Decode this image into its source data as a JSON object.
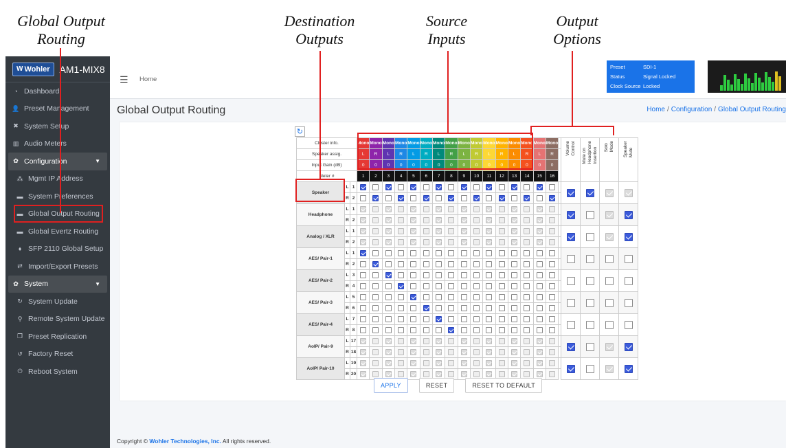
{
  "callouts": {
    "routing_l1": "Global Output",
    "routing_l2": "Routing",
    "dest_l1": "Destination",
    "dest_l2": "Outputs",
    "src_l1": "Source",
    "src_l2": "Inputs",
    "opt_l1": "Output",
    "opt_l2": "Options"
  },
  "brand": {
    "logo": "Wohler",
    "model": "AM1-MIX8"
  },
  "nav": [
    {
      "label": "Dashboard",
      "icon": "tachometer-icon",
      "glyph": "◔",
      "kind": "item"
    },
    {
      "label": "Preset Management",
      "icon": "users-icon",
      "glyph": "👤",
      "kind": "item"
    },
    {
      "label": "System Setup",
      "icon": "tools-icon",
      "glyph": "✖",
      "kind": "item"
    },
    {
      "label": "Audio Meters",
      "icon": "chart-icon",
      "glyph": "▥",
      "kind": "item"
    },
    {
      "label": "Configuration",
      "icon": "cog-icon",
      "glyph": "✿",
      "kind": "group"
    },
    {
      "label": "Mgmt IP Address",
      "icon": "network-icon",
      "glyph": "⁂",
      "kind": "sub"
    },
    {
      "label": "System Preferences",
      "icon": "card-icon",
      "glyph": "▬",
      "kind": "sub"
    },
    {
      "label": "Global Output Routing",
      "icon": "card-icon",
      "glyph": "▬",
      "kind": "sub"
    },
    {
      "label": "Global Evertz Routing",
      "icon": "card-icon",
      "glyph": "▬",
      "kind": "sub"
    },
    {
      "label": "SFP 2110 Global Setup",
      "icon": "plug-icon",
      "glyph": "♦",
      "kind": "sub"
    },
    {
      "label": "Import/Export Presets",
      "icon": "exchange-icon",
      "glyph": "⇄",
      "kind": "sub"
    },
    {
      "label": "System",
      "icon": "cogs-icon",
      "glyph": "✿",
      "kind": "group"
    },
    {
      "label": "System Update",
      "icon": "sync-icon",
      "glyph": "↻",
      "kind": "sub"
    },
    {
      "label": "Remote System Update",
      "icon": "satellite-icon",
      "glyph": "⚲",
      "kind": "sub"
    },
    {
      "label": "Preset Replication",
      "icon": "copy-icon",
      "glyph": "❐",
      "kind": "sub"
    },
    {
      "label": "Factory Reset",
      "icon": "undo-icon",
      "glyph": "↺",
      "kind": "sub"
    },
    {
      "label": "Reboot System",
      "icon": "power-icon",
      "glyph": "⏻",
      "kind": "sub"
    }
  ],
  "topbar": {
    "home": "Home"
  },
  "status": {
    "preset_label": "Preset",
    "preset_value": "SDI-1",
    "status_label": "Status",
    "status_value": "Signal Locked",
    "clock_label": "Clock Source",
    "clock_value": "Locked"
  },
  "page": {
    "title": "Global Output Routing",
    "crumb_home": "Home",
    "crumb_conf": "Configuration",
    "crumb_page": "Global Output Routing"
  },
  "grid": {
    "h_cluster": "Cluster info.",
    "h_speaker": "Speaker assig.",
    "h_gain": "Input Gain (dB)",
    "h_meter": "Meter #",
    "cluster": [
      "Mono",
      "Mono",
      "Mono",
      "Mono",
      "Mono",
      "Mono",
      "Mono",
      "Mono",
      "Mono",
      "Mono",
      "Mono",
      "Mono",
      "Mono",
      "Mono",
      "Mono",
      "Mono"
    ],
    "speaker": [
      "L",
      "R",
      "L",
      "R",
      "L",
      "R",
      "L",
      "R",
      "L",
      "R",
      "L",
      "R",
      "L",
      "R",
      "L",
      "R"
    ],
    "gain": [
      "0",
      "0",
      "0",
      "0",
      "0",
      "0",
      "0",
      "0",
      "0",
      "0",
      "0",
      "0",
      "0",
      "0",
      "0",
      "0"
    ],
    "meter": [
      "1",
      "2",
      "3",
      "4",
      "5",
      "6",
      "7",
      "8",
      "9",
      "10",
      "11",
      "12",
      "13",
      "14",
      "15",
      "16"
    ],
    "colors": [
      "#e53935",
      "#8e24aa",
      "#5e35b1",
      "#1e88e5",
      "#039be5",
      "#00acc1",
      "#00897b",
      "#43a047",
      "#7cb342",
      "#c0ca33",
      "#fdd835",
      "#ffb300",
      "#fb8c00",
      "#f4511e",
      "#e57373",
      "#8d6e63"
    ],
    "opt_headers": [
      "Volume\nControl",
      "Mute on\nHeadphone\nInsertion",
      "Solo\nMode",
      "Speaker\nMute"
    ],
    "dests": [
      {
        "name": "Speaker",
        "rows": [
          {
            "lr": "L",
            "ch": "1",
            "mode": "alt",
            "start": 1
          },
          {
            "lr": "R",
            "ch": "2",
            "mode": "alt",
            "start": 0
          }
        ],
        "opts": [
          "on",
          "on",
          "dison",
          "dison"
        ]
      },
      {
        "name": "Headphone",
        "rows": [
          {
            "lr": "L",
            "ch": "1",
            "mode": "dis"
          },
          {
            "lr": "R",
            "ch": "2",
            "mode": "dis"
          }
        ],
        "opts": [
          "on",
          "off",
          "dison",
          "on"
        ]
      },
      {
        "name": "Analog / XLR",
        "rows": [
          {
            "lr": "L",
            "ch": "1",
            "mode": "dis"
          },
          {
            "lr": "R",
            "ch": "2",
            "mode": "dis"
          }
        ],
        "opts": [
          "on",
          "off",
          "dison",
          "on"
        ]
      },
      {
        "name": "AES/ Pair-1",
        "rows": [
          {
            "lr": "L",
            "ch": "1",
            "mode": "one",
            "idx": 0
          },
          {
            "lr": "R",
            "ch": "2",
            "mode": "one",
            "idx": 1
          }
        ],
        "opts": [
          "off",
          "off",
          "off",
          "off"
        ]
      },
      {
        "name": "AES/ Pair-2",
        "rows": [
          {
            "lr": "L",
            "ch": "3",
            "mode": "one",
            "idx": 2
          },
          {
            "lr": "R",
            "ch": "4",
            "mode": "one",
            "idx": 3
          }
        ],
        "opts": [
          "off",
          "off",
          "off",
          "off"
        ]
      },
      {
        "name": "AES/ Pair-3",
        "rows": [
          {
            "lr": "L",
            "ch": "5",
            "mode": "one",
            "idx": 4
          },
          {
            "lr": "R",
            "ch": "6",
            "mode": "one",
            "idx": 5
          }
        ],
        "opts": [
          "off",
          "off",
          "off",
          "off"
        ]
      },
      {
        "name": "AES/ Pair-4",
        "rows": [
          {
            "lr": "L",
            "ch": "7",
            "mode": "one",
            "idx": 6
          },
          {
            "lr": "R",
            "ch": "8",
            "mode": "one",
            "idx": 7
          }
        ],
        "opts": [
          "off",
          "off",
          "off",
          "off"
        ]
      },
      {
        "name": "AoIP/ Pair-9",
        "rows": [
          {
            "lr": "L",
            "ch": "17",
            "mode": "dis"
          },
          {
            "lr": "R",
            "ch": "18",
            "mode": "dis"
          }
        ],
        "opts": [
          "on",
          "off",
          "dison",
          "on"
        ]
      },
      {
        "name": "AoIP/ Pair-10",
        "rows": [
          {
            "lr": "L",
            "ch": "19",
            "mode": "dis"
          },
          {
            "lr": "R",
            "ch": "20",
            "mode": "dis"
          }
        ],
        "opts": [
          "on",
          "off",
          "dison",
          "on"
        ]
      }
    ]
  },
  "buttons": {
    "apply": "APPLY",
    "reset": "RESET",
    "reset_default": "RESET TO DEFAULT"
  },
  "footer": {
    "prefix": "Copyright ©",
    "company": "Wohler Technologies, Inc.",
    "suffix": "All rights reserved."
  }
}
